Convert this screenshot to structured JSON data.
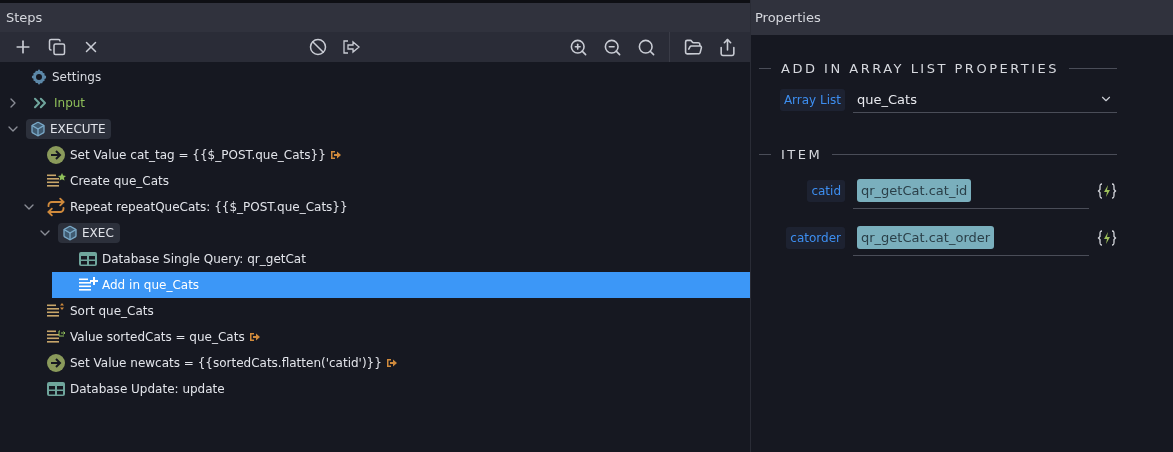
{
  "steps_panel": {
    "title": "Steps"
  },
  "steps": [
    {
      "kind": "settings",
      "label": "Settings",
      "selected": false,
      "output": false
    },
    {
      "kind": "input",
      "label": "Input",
      "selected": false,
      "output": false,
      "expanded": false
    },
    {
      "kind": "group",
      "label": "EXECUTE",
      "selected": false,
      "output": false,
      "expanded": true,
      "children": [
        {
          "kind": "setvalue",
          "label": "Set Value cat_tag = {{$_POST.que_Cats}}",
          "selected": false,
          "output": true
        },
        {
          "kind": "create",
          "label": "Create que_Cats",
          "selected": false,
          "output": false
        },
        {
          "kind": "repeat",
          "label": "Repeat repeatQueCats: {{$_POST.que_Cats}}",
          "selected": false,
          "output": false,
          "expanded": true,
          "children": [
            {
              "kind": "group",
              "label": "EXEC",
              "selected": false,
              "output": false,
              "expanded": true,
              "children": [
                {
                  "kind": "query",
                  "label": "Database Single Query: qr_getCat",
                  "selected": false,
                  "output": false
                },
                {
                  "kind": "add",
                  "label": "Add in que_Cats",
                  "selected": true,
                  "output": false
                }
              ]
            }
          ]
        },
        {
          "kind": "sort",
          "label": "Sort que_Cats",
          "selected": false,
          "output": false
        },
        {
          "kind": "value",
          "label": "Value sortedCats = que_Cats",
          "selected": false,
          "output": true
        },
        {
          "kind": "setvalue",
          "label": "Set Value newcats = {{sortedCats.flatten('catid')}}",
          "selected": false,
          "output": true
        },
        {
          "kind": "query",
          "label": "Database Update: update",
          "selected": false,
          "output": false
        }
      ]
    }
  ],
  "properties": {
    "title": "Properties",
    "sections": [
      {
        "title": "ADD IN ARRAY LIST PROPERTIES",
        "fields": [
          {
            "kind": "select",
            "label": "Array List",
            "value": "que_Cats"
          }
        ]
      },
      {
        "title": "ITEM",
        "fields": [
          {
            "kind": "expression",
            "label": "catid",
            "value": "qr_getCat.cat_id"
          },
          {
            "kind": "expression",
            "label": "catorder",
            "value": "qr_getCat.cat_order"
          }
        ]
      }
    ]
  }
}
